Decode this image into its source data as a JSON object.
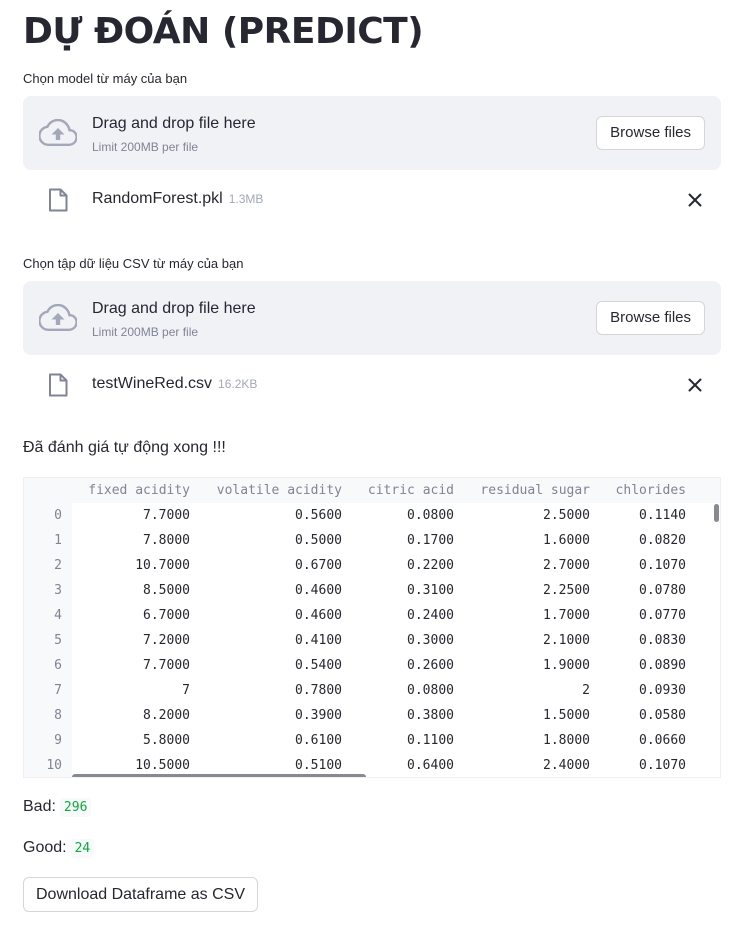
{
  "page": {
    "title": "DỰ ĐOÁN (PREDICT)"
  },
  "model_upload": {
    "label": "Chọn model từ máy của bạn",
    "dropzone_title": "Drag and drop file here",
    "dropzone_limit": "Limit 200MB per file",
    "browse_label": "Browse files",
    "file_name": "RandomForest.pkl",
    "file_size": "1.3MB"
  },
  "csv_upload": {
    "label": "Chọn tập dữ liệu CSV từ máy của bạn",
    "dropzone_title": "Drag and drop file here",
    "dropzone_limit": "Limit 200MB per file",
    "browse_label": "Browse files",
    "file_name": "testWineRed.csv",
    "file_size": "16.2KB"
  },
  "status_message": "Đã đánh giá tự động xong !!!",
  "dataframe": {
    "columns": [
      "fixed acidity",
      "volatile acidity",
      "citric acid",
      "residual sugar",
      "chlorides"
    ],
    "rows": [
      {
        "index": "0",
        "cells": [
          "7.7000",
          "0.5600",
          "0.0800",
          "2.5000",
          "0.1140"
        ]
      },
      {
        "index": "1",
        "cells": [
          "7.8000",
          "0.5000",
          "0.1700",
          "1.6000",
          "0.0820"
        ]
      },
      {
        "index": "2",
        "cells": [
          "10.7000",
          "0.6700",
          "0.2200",
          "2.7000",
          "0.1070"
        ]
      },
      {
        "index": "3",
        "cells": [
          "8.5000",
          "0.4600",
          "0.3100",
          "2.2500",
          "0.0780"
        ]
      },
      {
        "index": "4",
        "cells": [
          "6.7000",
          "0.4600",
          "0.2400",
          "1.7000",
          "0.0770"
        ]
      },
      {
        "index": "5",
        "cells": [
          "7.2000",
          "0.4100",
          "0.3000",
          "2.1000",
          "0.0830"
        ]
      },
      {
        "index": "6",
        "cells": [
          "7.7000",
          "0.5400",
          "0.2600",
          "1.9000",
          "0.0890"
        ]
      },
      {
        "index": "7",
        "cells": [
          "7",
          "0.7800",
          "0.0800",
          "2",
          "0.0930"
        ]
      },
      {
        "index": "8",
        "cells": [
          "8.2000",
          "0.3900",
          "0.3800",
          "1.5000",
          "0.0580"
        ]
      },
      {
        "index": "9",
        "cells": [
          "5.8000",
          "0.6100",
          "0.1100",
          "1.8000",
          "0.0660"
        ]
      },
      {
        "index": "10",
        "cells": [
          "10.5000",
          "0.5100",
          "0.6400",
          "2.4000",
          "0.1070"
        ]
      }
    ]
  },
  "results": {
    "bad_label": "Bad:",
    "bad_value": "296",
    "good_label": "Good:",
    "good_value": "24"
  },
  "download_label": "Download Dataframe as CSV",
  "icons": {
    "upload": "cloud-upload-icon",
    "file": "file-icon",
    "close": "close-icon"
  },
  "colors": {
    "dropzone_bg": "#f0f2f6",
    "value_green": "#09ab3b",
    "muted_text": "#808495"
  }
}
